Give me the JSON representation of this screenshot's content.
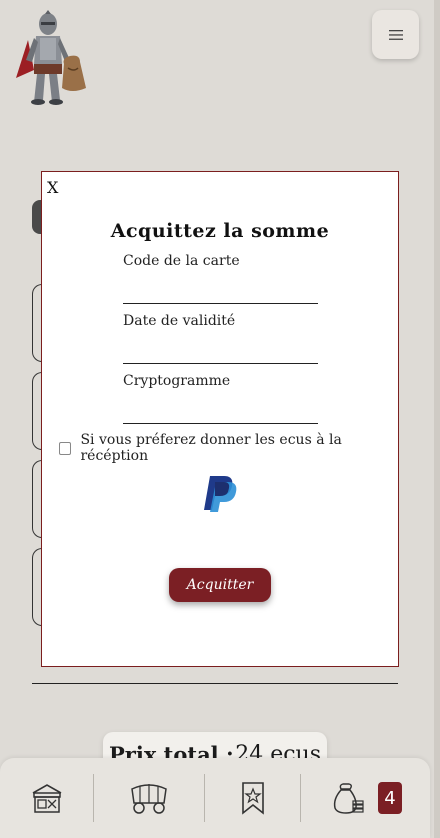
{
  "header": {
    "logo_name": "knight-with-bag-logo",
    "menu_icon": "hamburger-icon"
  },
  "total": {
    "label": "Prix total :",
    "value": "24 ecus"
  },
  "modal": {
    "close_label": "X",
    "title": "Acquittez la somme",
    "fields": [
      {
        "label": "Code de la carte",
        "value": "",
        "placeholder": ""
      },
      {
        "label": "Date de validité",
        "value": "",
        "placeholder": ""
      },
      {
        "label": "Cryptogramme",
        "value": "",
        "placeholder": ""
      }
    ],
    "checkbox_label": "Si vous préferez donner les ecus à la récéption",
    "checkbox_checked": false,
    "paypal_icon": "paypal-icon",
    "submit_label": "Acquitter"
  },
  "nav": {
    "items": [
      {
        "icon": "shop-stall-icon"
      },
      {
        "icon": "wagon-icon"
      },
      {
        "icon": "bookmark-star-icon"
      },
      {
        "icon": "money-bag-icon"
      }
    ],
    "cart_count": "4"
  },
  "colors": {
    "background": "#dedbd6",
    "accent": "#7b1f24",
    "modal_border": "#7b1e1e"
  }
}
